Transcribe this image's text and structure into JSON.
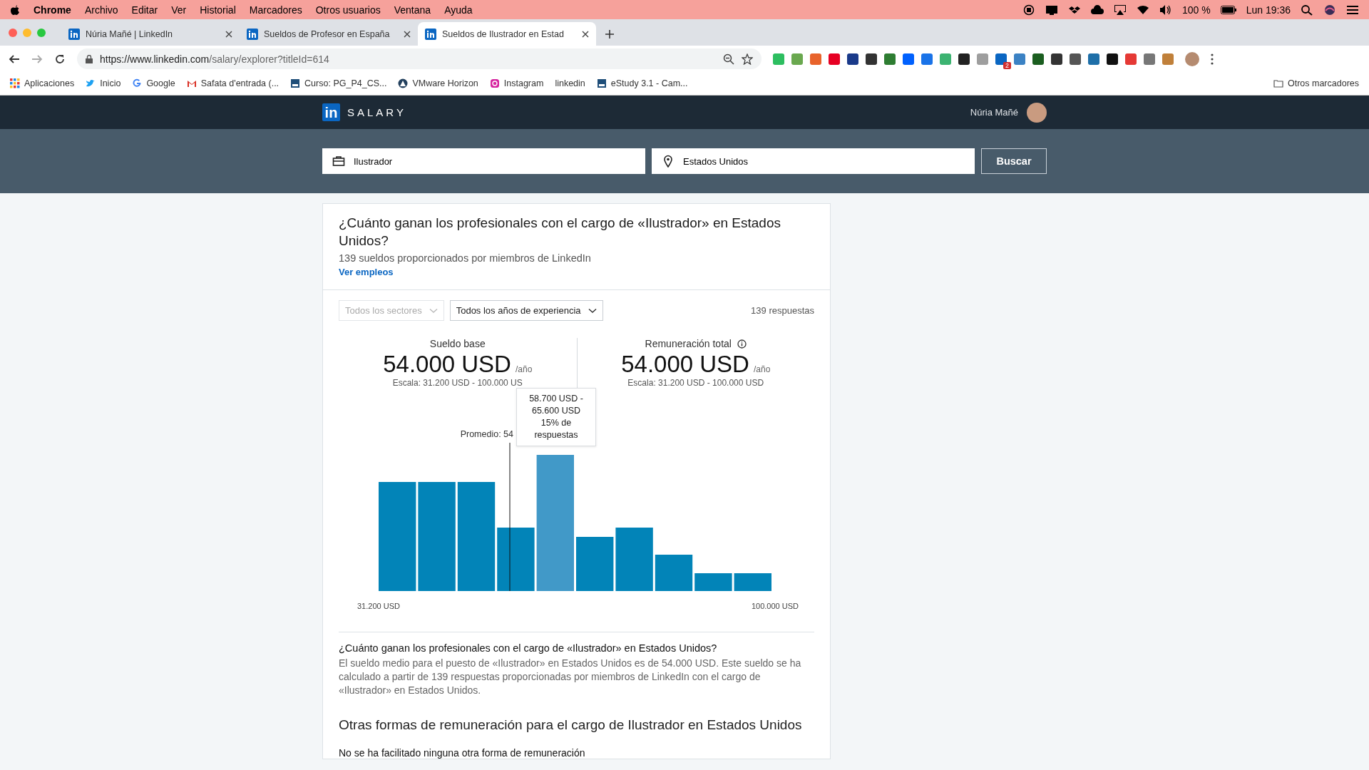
{
  "menu_bar": {
    "app": "Chrome",
    "items": [
      "Archivo",
      "Editar",
      "Ver",
      "Historial",
      "Marcadores",
      "Otros usuarios",
      "Ventana",
      "Ayuda"
    ],
    "battery": "100 %",
    "clock": "Lun 19:36"
  },
  "tabs": [
    {
      "title": "Núria Mañé | LinkedIn",
      "selected": false
    },
    {
      "title": "Sueldos de Profesor en España",
      "selected": false
    },
    {
      "title": "Sueldos de Ilustrador en Estad",
      "selected": true
    }
  ],
  "address_bar": {
    "url_host": "https://www.linkedin.com",
    "url_path": "/salary/explorer?titleId=614",
    "extension_badge": "2"
  },
  "bookmarks": [
    {
      "kind": "apps",
      "label": "Aplicaciones"
    },
    {
      "kind": "bird",
      "label": "Inicio"
    },
    {
      "kind": "g",
      "label": "Google"
    },
    {
      "kind": "mail",
      "label": "Safata d'entrada (..."
    },
    {
      "kind": "doc",
      "label": "Curso: PG_P4_CS..."
    },
    {
      "kind": "vm",
      "label": "VMware Horizon"
    },
    {
      "kind": "camera",
      "label": "Instagram"
    },
    {
      "kind": "none",
      "label": "linkedin"
    },
    {
      "kind": "doc",
      "label": "eStudy 3.1 - Cam..."
    }
  ],
  "other_bookmarks": "Otros marcadores",
  "site_header": {
    "logo": "in",
    "brand": "SALARY",
    "user": "Núria Mañé"
  },
  "search": {
    "title_value": "Ilustrador",
    "location_value": "Estados Unidos",
    "button": "Buscar"
  },
  "card": {
    "title": "¿Cuánto ganan los profesionales con el cargo de «Ilustrador» en Estados Unidos?",
    "subtitle": "139 sueldos proporcionados por miembros de LinkedIn",
    "link": "Ver empleos",
    "filters": [
      {
        "label": "Todos los sectores",
        "disabled": true
      },
      {
        "label": "Todos los años de experiencia",
        "disabled": false
      }
    ],
    "responses": "139 respuestas",
    "stats": [
      {
        "label": "Sueldo base",
        "info": false,
        "value": "54.000 USD",
        "unit": "/año",
        "range": "Escala: 31.200 USD - 100.000 US"
      },
      {
        "label": "Remuneración total",
        "info": true,
        "value": "54.000 USD",
        "unit": "/año",
        "range": "Escala: 31.200 USD - 100.000 USD"
      }
    ],
    "histogram": {
      "average_label": "Promedio: 54",
      "min_label": "31.200 USD",
      "max_label": "100.000 USD",
      "tooltip": {
        "range": "58.700 USD - 65.600 USD",
        "share": "15% de respuestas"
      },
      "bars": [
        {
          "selected": false
        },
        {
          "selected": false
        },
        {
          "selected": false
        },
        {
          "selected": false
        },
        {
          "selected": true
        },
        {
          "selected": false
        },
        {
          "selected": false
        },
        {
          "selected": false
        },
        {
          "selected": false
        },
        {
          "selected": false
        }
      ]
    },
    "question": "¿Cuánto ganan los profesionales con el cargo de «Ilustrador» en Estados Unidos?",
    "answer": "El sueldo medio para el puesto de «Ilustrador» en Estados Unidos es de 54.000 USD. Este sueldo se ha calculado a partir de 139 respuestas proporcionadas por miembros de LinkedIn con el cargo de «Ilustrador» en Estados Unidos.",
    "other_title": "Otras formas de remuneración para el cargo de Ilustrador en Estados Unidos",
    "other_text": "No se ha facilitado ninguna otra forma de remuneración"
  }
}
